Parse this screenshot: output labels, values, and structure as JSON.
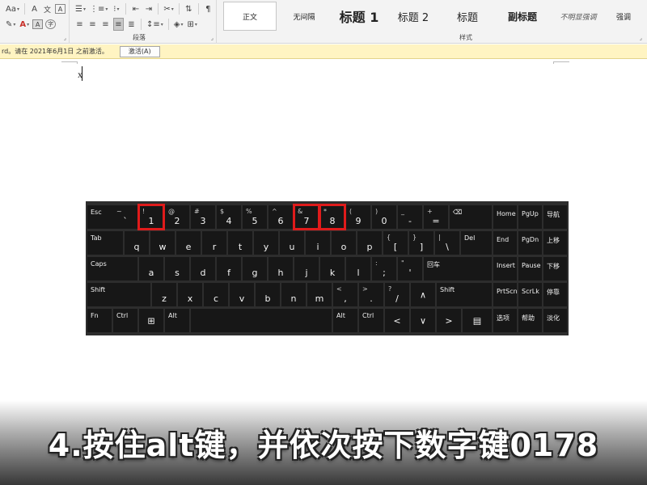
{
  "ribbon": {
    "font_group": {
      "row1": [
        "Aa",
        "A",
        "A"
      ],
      "row2": [
        "A",
        "A",
        "A"
      ],
      "icons": [
        "change-case-icon",
        "clear-formatting-icon",
        "character-border-icon",
        "text-highlight-icon",
        "font-color-icon",
        "character-shading-icon",
        "enclosed-character-icon"
      ]
    },
    "paragraph_group": {
      "label": "段落",
      "icons": [
        "bullets-icon",
        "numbering-icon",
        "multilevel-list-icon",
        "decrease-indent-icon",
        "increase-indent-icon",
        "chinese-layout-icon",
        "sort-icon",
        "show-marks-icon",
        "align-left-icon",
        "align-center-icon",
        "align-right-icon",
        "justify-icon",
        "distributed-icon",
        "line-spacing-icon",
        "shading-icon",
        "borders-icon"
      ]
    },
    "styles_group": {
      "label": "样式",
      "styles": [
        "正文",
        "无间隔",
        "标题 1",
        "标题 2",
        "标题",
        "副标题",
        "不明显强调",
        "强调"
      ]
    }
  },
  "notification": {
    "text": "rd。请在 2021年6月1日 之前激活。",
    "button": "激活(A)"
  },
  "document": {
    "typed_text": "x"
  },
  "keyboard": {
    "row1": [
      {
        "top": "Esc",
        "bottom": ""
      },
      {
        "top": "~",
        "bottom": "`"
      },
      {
        "top": "!",
        "bottom": "1",
        "highlight": true
      },
      {
        "top": "@",
        "bottom": "2"
      },
      {
        "top": "#",
        "bottom": "3"
      },
      {
        "top": "$",
        "bottom": "4"
      },
      {
        "top": "%",
        "bottom": "5"
      },
      {
        "top": "^",
        "bottom": "6"
      },
      {
        "top": "&",
        "bottom": "7",
        "highlight": true
      },
      {
        "top": "*",
        "bottom": "8",
        "highlight": true
      },
      {
        "top": "(",
        "bottom": "9"
      },
      {
        "top": ")",
        "bottom": "0"
      },
      {
        "top": "_",
        "bottom": "-"
      },
      {
        "top": "+",
        "bottom": "="
      },
      {
        "top": "⌫",
        "bottom": ""
      }
    ],
    "row2": [
      {
        "top": "Tab",
        "bottom": ""
      },
      {
        "top": "",
        "bottom": "q"
      },
      {
        "top": "",
        "bottom": "w"
      },
      {
        "top": "",
        "bottom": "e"
      },
      {
        "top": "",
        "bottom": "r"
      },
      {
        "top": "",
        "bottom": "t"
      },
      {
        "top": "",
        "bottom": "y"
      },
      {
        "top": "",
        "bottom": "u"
      },
      {
        "top": "",
        "bottom": "i"
      },
      {
        "top": "",
        "bottom": "o"
      },
      {
        "top": "",
        "bottom": "p"
      },
      {
        "top": "{",
        "bottom": "["
      },
      {
        "top": "}",
        "bottom": "]"
      },
      {
        "top": "|",
        "bottom": "\\"
      },
      {
        "top": "Del",
        "bottom": ""
      }
    ],
    "row3": [
      {
        "top": "Caps",
        "bottom": ""
      },
      {
        "top": "",
        "bottom": "a"
      },
      {
        "top": "",
        "bottom": "s"
      },
      {
        "top": "",
        "bottom": "d"
      },
      {
        "top": "",
        "bottom": "f"
      },
      {
        "top": "",
        "bottom": "g"
      },
      {
        "top": "",
        "bottom": "h"
      },
      {
        "top": "",
        "bottom": "j"
      },
      {
        "top": "",
        "bottom": "k"
      },
      {
        "top": "",
        "bottom": "l"
      },
      {
        "top": ":",
        "bottom": ";"
      },
      {
        "top": "\"",
        "bottom": "'"
      },
      {
        "top": "回车",
        "bottom": ""
      }
    ],
    "row4": [
      {
        "top": "Shift",
        "bottom": ""
      },
      {
        "top": "",
        "bottom": "z"
      },
      {
        "top": "",
        "bottom": "x"
      },
      {
        "top": "",
        "bottom": "c"
      },
      {
        "top": "",
        "bottom": "v"
      },
      {
        "top": "",
        "bottom": "b"
      },
      {
        "top": "",
        "bottom": "n"
      },
      {
        "top": "",
        "bottom": "m"
      },
      {
        "top": "<",
        "bottom": ","
      },
      {
        "top": ">",
        "bottom": "."
      },
      {
        "top": "?",
        "bottom": "/"
      },
      {
        "top": "",
        "bottom": "",
        "glyph": "∧"
      },
      {
        "top": "Shift",
        "bottom": ""
      }
    ],
    "row5": [
      {
        "top": "Fn",
        "bottom": ""
      },
      {
        "top": "Ctrl",
        "bottom": ""
      },
      {
        "top": "",
        "bottom": "",
        "glyph": "⊞"
      },
      {
        "top": "Alt",
        "bottom": ""
      },
      {
        "top": "",
        "bottom": ""
      },
      {
        "top": "Alt",
        "bottom": ""
      },
      {
        "top": "Ctrl",
        "bottom": ""
      },
      {
        "top": "",
        "bottom": "",
        "glyph": "<"
      },
      {
        "top": "",
        "bottom": "",
        "glyph": "∨"
      },
      {
        "top": "",
        "bottom": "",
        "glyph": ">"
      },
      {
        "top": "",
        "bottom": "",
        "glyph": "▤"
      }
    ],
    "nav": [
      [
        "Home",
        "PgUp",
        "导航"
      ],
      [
        "End",
        "PgDn",
        "上移"
      ],
      [
        "Insert",
        "Pause",
        "下移"
      ],
      [
        "PrtScn",
        "ScrLk",
        "停靠"
      ],
      [
        "选项",
        "帮助",
        "淡化"
      ]
    ]
  },
  "caption": "4.按住alt键，并依次按下数字键0178"
}
